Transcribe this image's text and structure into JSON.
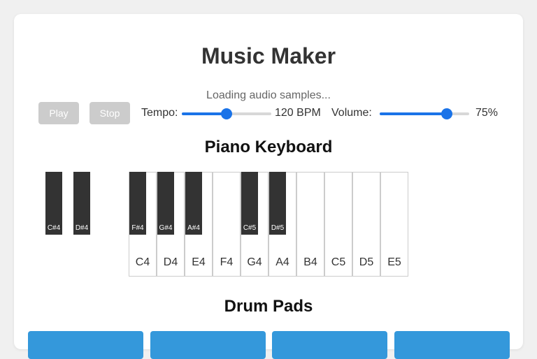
{
  "app": {
    "title": "Music Maker",
    "status": "Loading audio samples..."
  },
  "transport": {
    "play_label": "Play",
    "stop_label": "Stop"
  },
  "tempo": {
    "label": "Tempo:",
    "value_text": "120 BPM",
    "fraction": 0.5
  },
  "volume": {
    "label": "Volume:",
    "value_text": "75%",
    "fraction": 0.75
  },
  "keyboard": {
    "title": "Piano Keyboard",
    "white_keys": [
      "C4",
      "D4",
      "E4",
      "F4",
      "G4",
      "A4",
      "B4",
      "C5",
      "D5",
      "E5"
    ],
    "black_keys": [
      "C#4",
      "D#4",
      "F#4",
      "G#4",
      "A#4",
      "C#5",
      "D#5"
    ]
  },
  "drums": {
    "title": "Drum Pads",
    "pad_count": 4
  },
  "colors": {
    "accent": "#1a73e8",
    "disabled_button": "#cccccc",
    "black_key": "#333333",
    "drum_pad": "#3498db"
  }
}
